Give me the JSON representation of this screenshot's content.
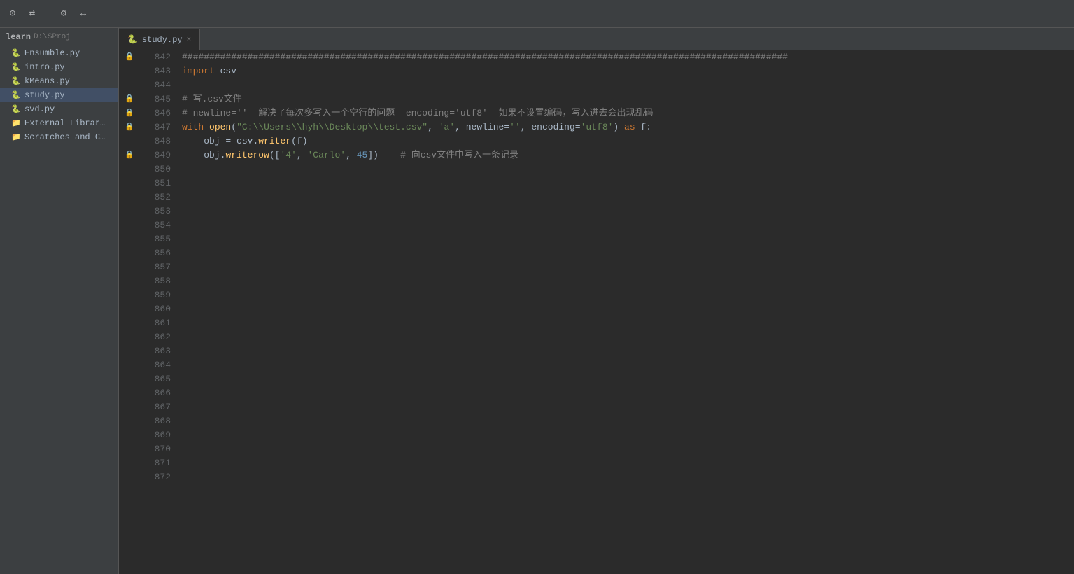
{
  "toolbar": {
    "icons": [
      "⊙",
      "⇄",
      "⚙",
      "↔"
    ]
  },
  "tab": {
    "icon": "🐍",
    "label": "study.py",
    "close": "×"
  },
  "sidebar": {
    "header": "learn",
    "path": "D:\\SProj",
    "items": [
      {
        "id": "ensumble",
        "label": "Ensumble.py",
        "icon": "🐍"
      },
      {
        "id": "intro",
        "label": "intro.py",
        "icon": "🐍"
      },
      {
        "id": "kmeans",
        "label": "kMeans.py",
        "icon": "🐍"
      },
      {
        "id": "study",
        "label": "study.py",
        "icon": "🐍",
        "active": true
      },
      {
        "id": "svd",
        "label": "svd.py",
        "icon": "🐍"
      },
      {
        "id": "external",
        "label": "External Librar…",
        "icon": "📁"
      },
      {
        "id": "scratches",
        "label": "Scratches and C…",
        "icon": "📁"
      }
    ]
  },
  "lines": [
    {
      "num": 842,
      "gutter": "lock",
      "code": "hash_line",
      "content": "###############################################################################################################"
    },
    {
      "num": 843,
      "gutter": "",
      "code": "import_line",
      "content": "import csv"
    },
    {
      "num": 844,
      "gutter": "",
      "code": "blank",
      "content": ""
    },
    {
      "num": 845,
      "gutter": "lock",
      "code": "comment1",
      "content": "# 写.csv文件"
    },
    {
      "num": 846,
      "gutter": "lock",
      "code": "comment2",
      "content": "# newline=''  解决了每次多写入一个空行的问题  encoding='utf8'  如果不设置编码，写入进去会出现乱码"
    },
    {
      "num": 847,
      "gutter": "lock",
      "code": "with_line",
      "content": "with open(\"C:\\\\Users\\\\hyh\\\\Desktop\\\\test.csv\", 'a', newline='', encoding='utf8') as f:"
    },
    {
      "num": 848,
      "gutter": "",
      "code": "obj_line",
      "content": "    obj = csv.writer(f)"
    },
    {
      "num": 849,
      "gutter": "lock_bulb",
      "code": "writerow_line",
      "content": "    obj.writerow(['4', 'Carlo', 45])    # 向csv文件中写入一条记录"
    },
    {
      "num": 850,
      "gutter": "",
      "code": "blank",
      "content": ""
    },
    {
      "num": 851,
      "gutter": "",
      "code": "blank",
      "content": ""
    },
    {
      "num": 852,
      "gutter": "",
      "code": "blank",
      "content": ""
    },
    {
      "num": 853,
      "gutter": "",
      "code": "blank",
      "content": ""
    },
    {
      "num": 854,
      "gutter": "",
      "code": "blank",
      "content": ""
    },
    {
      "num": 855,
      "gutter": "",
      "code": "blank",
      "content": ""
    },
    {
      "num": 856,
      "gutter": "",
      "code": "blank",
      "content": ""
    },
    {
      "num": 857,
      "gutter": "",
      "code": "blank",
      "content": ""
    },
    {
      "num": 858,
      "gutter": "",
      "code": "blank",
      "content": ""
    },
    {
      "num": 859,
      "gutter": "",
      "code": "blank",
      "content": ""
    },
    {
      "num": 860,
      "gutter": "",
      "code": "blank",
      "content": ""
    },
    {
      "num": 861,
      "gutter": "",
      "code": "blank",
      "content": ""
    },
    {
      "num": 862,
      "gutter": "",
      "code": "blank",
      "content": ""
    },
    {
      "num": 863,
      "gutter": "",
      "code": "blank",
      "content": ""
    },
    {
      "num": 864,
      "gutter": "",
      "code": "blank",
      "content": ""
    },
    {
      "num": 865,
      "gutter": "",
      "code": "blank",
      "content": ""
    },
    {
      "num": 866,
      "gutter": "",
      "code": "blank",
      "content": ""
    },
    {
      "num": 867,
      "gutter": "",
      "code": "blank",
      "content": ""
    },
    {
      "num": 868,
      "gutter": "",
      "code": "blank",
      "content": ""
    },
    {
      "num": 869,
      "gutter": "",
      "code": "blank",
      "content": ""
    },
    {
      "num": 870,
      "gutter": "",
      "code": "blank",
      "content": ""
    },
    {
      "num": 871,
      "gutter": "",
      "code": "blank",
      "content": ""
    },
    {
      "num": 872,
      "gutter": "",
      "code": "blank",
      "content": ""
    }
  ]
}
